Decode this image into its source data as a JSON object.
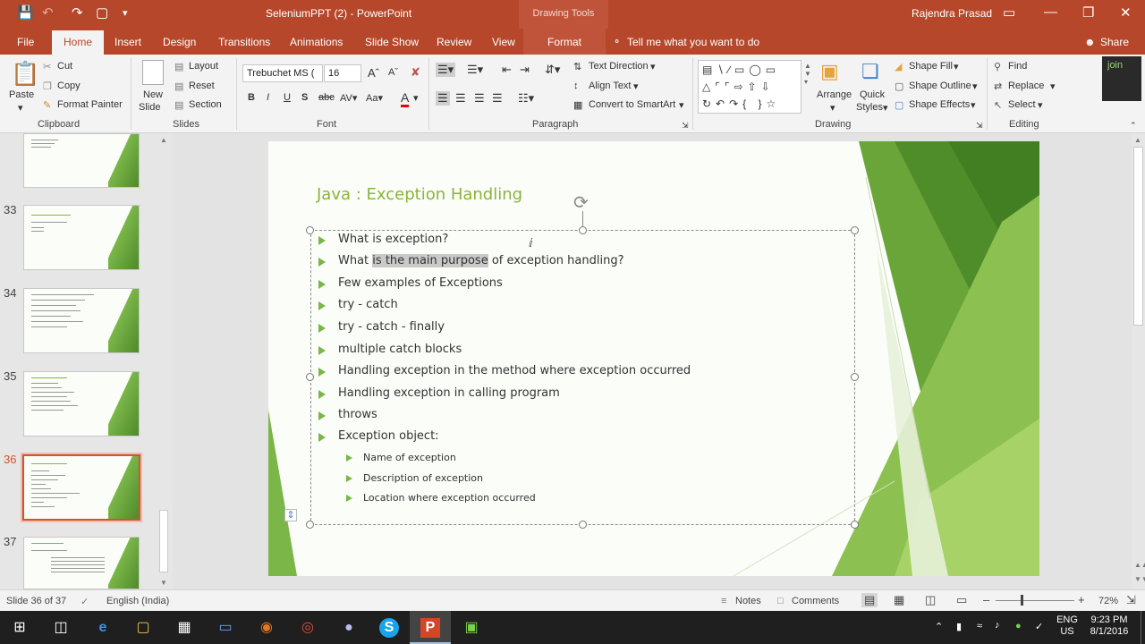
{
  "titlebar": {
    "title": "SeleniumPPT (2) - PowerPoint",
    "context": "Drawing Tools",
    "user": "Rajendra Prasad",
    "icons": [
      "save-icon",
      "undo-icon",
      "redo-icon",
      "present-icon",
      "customize-icon"
    ]
  },
  "tabs": {
    "file": "File",
    "home": "Home",
    "insert": "Insert",
    "design": "Design",
    "transitions": "Transitions",
    "animations": "Animations",
    "slideshow": "Slide Show",
    "review": "Review",
    "view": "View",
    "format": "Format",
    "tellme": "Tell me what you want to do",
    "share": "Share"
  },
  "ribbon": {
    "clipboard": {
      "group": "Clipboard",
      "paste": "Paste",
      "cut": "Cut",
      "copy": "Copy",
      "format_painter": "Format Painter"
    },
    "slides": {
      "group": "Slides",
      "new_slide": "New",
      "new_slide2": "Slide",
      "layout": "Layout",
      "reset": "Reset",
      "section": "Section"
    },
    "font": {
      "group": "Font",
      "name": "Trebuchet MS (",
      "size": "16"
    },
    "paragraph": {
      "group": "Paragraph",
      "text_direction": "Text Direction",
      "align_text": "Align Text",
      "smartart": "Convert to SmartArt"
    },
    "drawing": {
      "group": "Drawing",
      "arrange": "Arrange",
      "quick_styles": "Quick",
      "quick_styles2": "Styles",
      "shape_fill": "Shape Fill",
      "shape_outline": "Shape Outline",
      "shape_effects": "Shape Effects"
    },
    "editing": {
      "group": "Editing",
      "find": "Find",
      "replace": "Replace",
      "select": "Select"
    },
    "join": "join"
  },
  "thumbnails": [
    {
      "num": ""
    },
    {
      "num": "33"
    },
    {
      "num": "34"
    },
    {
      "num": "35"
    },
    {
      "num": "36",
      "selected": true
    },
    {
      "num": "37"
    }
  ],
  "slide": {
    "title": "Java : Exception Handling",
    "bullets": [
      "What is exception?",
      "What is the main purpose of exception handling?",
      "Few examples of Exceptions",
      "try - catch",
      "try - catch - finally",
      "multiple catch blocks",
      "Handling exception in the method where exception occurred",
      "Handling exception in calling program",
      "throws",
      "Exception object:"
    ],
    "bullet2_pre": "What ",
    "bullet2_hl": "is the main purpose",
    "bullet2_post": " of exception handling?",
    "subbullets": [
      "Name of exception",
      "Description of exception",
      "Location where exception occurred"
    ]
  },
  "status": {
    "slide_info": "Slide 36 of 37",
    "language": "English (India)",
    "notes": "Notes",
    "comments": "Comments",
    "zoom": "72%"
  },
  "taskbar": {
    "lang1": "ENG",
    "lang2": "US",
    "time": "9:23 PM",
    "date": "8/1/2016"
  }
}
